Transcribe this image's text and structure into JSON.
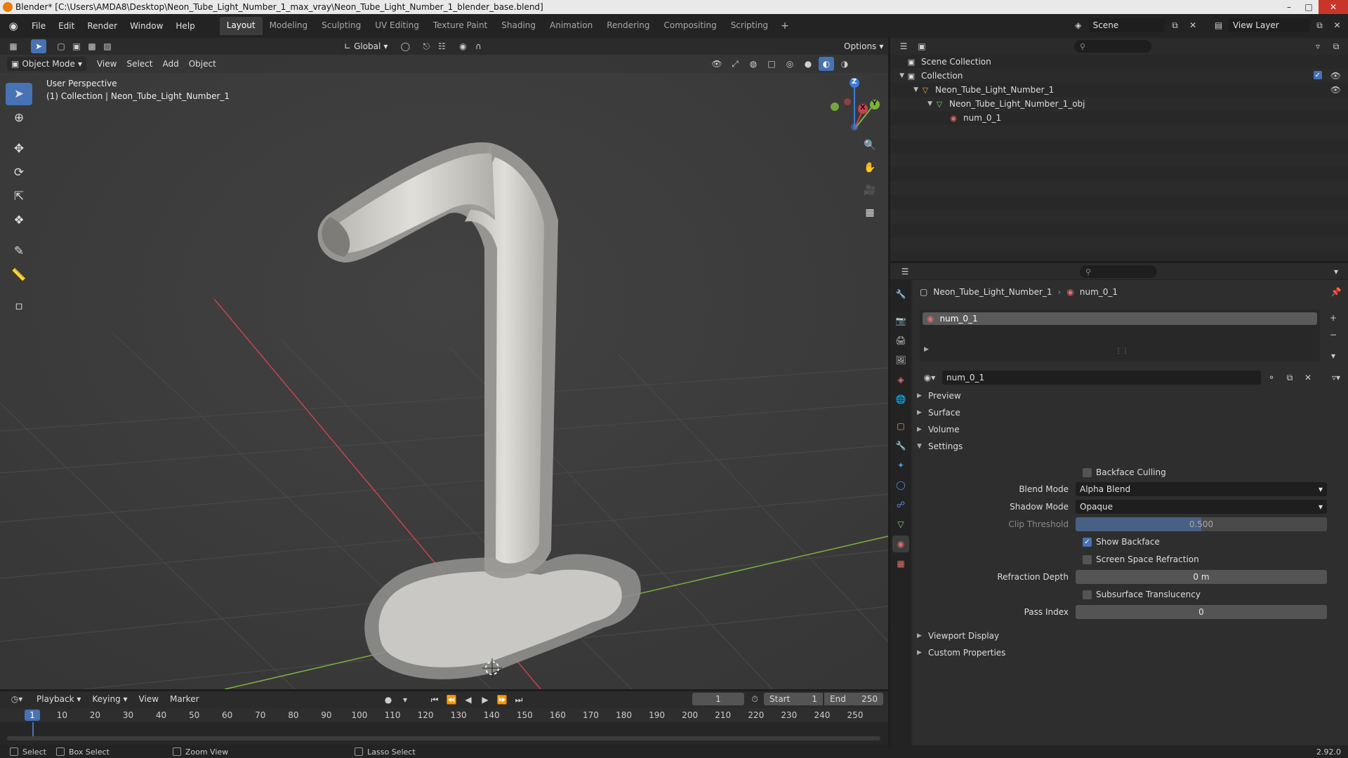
{
  "window": {
    "title": "Blender* [C:\\Users\\AMDA8\\Desktop\\Neon_Tube_Light_Number_1_max_vray\\Neon_Tube_Light_Number_1_blender_base.blend]",
    "minimize": "–",
    "maximize": "□",
    "close": "✕"
  },
  "menu": {
    "file": "File",
    "edit": "Edit",
    "render": "Render",
    "window": "Window",
    "help": "Help"
  },
  "workspaces": [
    "Layout",
    "Modeling",
    "Sculpting",
    "UV Editing",
    "Texture Paint",
    "Shading",
    "Animation",
    "Rendering",
    "Compositing",
    "Scripting"
  ],
  "workspace_add": "+",
  "scene": {
    "name": "Scene"
  },
  "view_layer": {
    "name": "View Layer"
  },
  "viewport": {
    "transform_orientation": "Global",
    "options": "Options",
    "mode": "Object Mode",
    "menus": {
      "view": "View",
      "select": "Select",
      "add": "Add",
      "object": "Object"
    },
    "info_line1": "User Perspective",
    "info_line2": "(1) Collection | Neon_Tube_Light_Number_1",
    "gizmo": {
      "x": "X",
      "y": "Y",
      "z": "Z"
    }
  },
  "outliner": {
    "root": "Scene Collection",
    "collection": "Collection",
    "object": "Neon_Tube_Light_Number_1",
    "mesh": "Neon_Tube_Light_Number_1_obj",
    "material": "num_0_1"
  },
  "properties": {
    "crumb_object": "Neon_Tube_Light_Number_1",
    "crumb_material": "num_0_1",
    "slot_name": "num_0_1",
    "material_name": "num_0_1",
    "panels": {
      "preview": "Preview",
      "surface": "Surface",
      "volume": "Volume",
      "settings": "Settings",
      "viewport_display": "Viewport Display",
      "custom_properties": "Custom Properties"
    },
    "settings": {
      "backface_culling": {
        "label": "Backface Culling",
        "checked": false
      },
      "blend_mode": {
        "label": "Blend Mode",
        "value": "Alpha Blend"
      },
      "shadow_mode": {
        "label": "Shadow Mode",
        "value": "Opaque"
      },
      "clip_threshold": {
        "label": "Clip Threshold",
        "value": "0.500",
        "fraction": 0.5
      },
      "show_backface": {
        "label": "Show Backface",
        "checked": true
      },
      "screen_space_refraction": {
        "label": "Screen Space Refraction",
        "checked": false
      },
      "refraction_depth": {
        "label": "Refraction Depth",
        "value": "0 m"
      },
      "subsurface_translucency": {
        "label": "Subsurface Translucency",
        "checked": false
      },
      "pass_index": {
        "label": "Pass Index",
        "value": "0"
      }
    }
  },
  "timeline": {
    "menus": {
      "playback": "Playback",
      "keying": "Keying",
      "view": "View",
      "marker": "Marker"
    },
    "current_frame": "1",
    "start_label": "Start",
    "start_value": "1",
    "end_label": "End",
    "end_value": "250",
    "ticks": [
      "10",
      "20",
      "30",
      "40",
      "50",
      "60",
      "70",
      "80",
      "90",
      "100",
      "110",
      "120",
      "130",
      "140",
      "150",
      "160",
      "170",
      "180",
      "190",
      "200",
      "210",
      "220",
      "230",
      "240",
      "250"
    ],
    "playhead": "1"
  },
  "statusbar": {
    "select": "Select",
    "box_select": "Box Select",
    "zoom_view": "Zoom View",
    "lasso_select": "Lasso Select",
    "version": "2.92.0"
  },
  "colors": {
    "accent": "#4772b3",
    "viewport_bg": "#3d3d3d",
    "panel_bg": "#2b2b2b",
    "axis_x": "#c8444b",
    "axis_y": "#7bb33d",
    "axis_z": "#3d7bd6"
  }
}
